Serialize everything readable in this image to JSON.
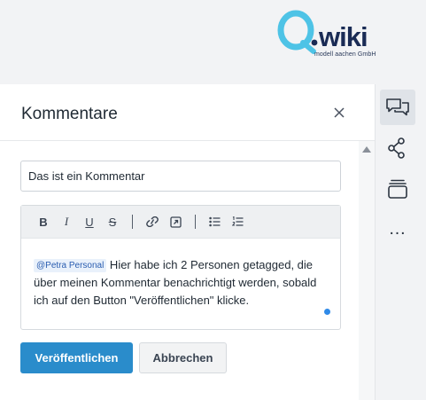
{
  "logo": {
    "wordmark": "Q.wiki",
    "tagline": "modell aachen GmbH"
  },
  "panel": {
    "title": "Kommentare",
    "close_icon": "close-icon"
  },
  "rail": {
    "items": [
      {
        "name": "comments",
        "icon": "comments-icon",
        "active": true
      },
      {
        "name": "share",
        "icon": "share-icon",
        "active": false
      },
      {
        "name": "versions",
        "icon": "layers-icon",
        "active": false
      }
    ],
    "more_label": "…"
  },
  "form": {
    "title_value": "Das ist ein Kommentar",
    "toolbar": {
      "bold": "B",
      "italic": "I",
      "underline": "U",
      "strike": "S"
    },
    "mention": "@Petra Personal",
    "body_text": " Hier habe ich 2 Personen getagged, die über meinen Kommentar benachrichtigt werden, sobald ich auf den Button \"Veröffentlichen\" klicke."
  },
  "actions": {
    "publish_label": "Veröffentlichen",
    "cancel_label": "Abbrechen"
  },
  "colors": {
    "accent": "#2a8ccb",
    "logo_cyan": "#4ec3e6",
    "logo_navy": "#1a2b55"
  }
}
